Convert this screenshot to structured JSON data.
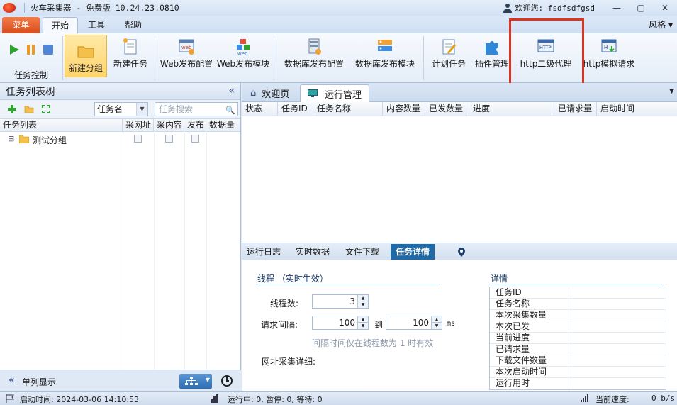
{
  "window": {
    "title": "火车采集器 - 免费版 10.24.23.0810",
    "user_label": "欢迎您: fsdfsdfgsd",
    "controls": [
      "—",
      "▢",
      "✕"
    ]
  },
  "ribbon_tabs": {
    "menu": "菜单",
    "tabs": [
      "开始",
      "工具",
      "帮助"
    ],
    "style_menu": "风格 ▾"
  },
  "ribbon": {
    "task_control_label": "任务控制",
    "buttons": {
      "new_group": "新建分组",
      "new_task": "新建任务",
      "web_publish_config": "Web发布配置",
      "web_publish_module": "Web发布模块",
      "db_publish_config": "数据库发布配置",
      "db_publish_module": "数据库发布模块",
      "scheduled_task": "计划任务",
      "plugin_manage": "插件管理",
      "http_proxy": "http二级代理",
      "http_simulate": "http模拟请求"
    },
    "icon_texts": {
      "web": "web",
      "http": "HTTP",
      "h": "H"
    }
  },
  "left_panel": {
    "title": "任务列表树",
    "collapse": "«",
    "filter_select": "任务名",
    "search_placeholder": "任务搜索",
    "columns": [
      "任务列表",
      "采网址",
      "采内容",
      "发布",
      "数据量"
    ],
    "tree_items": [
      {
        "expander": "⊞",
        "label": "测试分组"
      }
    ],
    "footer": {
      "toggle": "«",
      "single_view": "单列显示"
    }
  },
  "doc_tabs": {
    "welcome": "欢迎页",
    "run_manage": "运行管理"
  },
  "grid": {
    "columns": [
      "状态",
      "任务ID",
      "任务名称",
      "内容数量",
      "已发数量",
      "进度",
      "已请求量",
      "启动时间"
    ]
  },
  "bottom_tabs": [
    "运行日志",
    "实时数据",
    "文件下载",
    "任务详情"
  ],
  "detail": {
    "section_title": "线程 （实时生效）",
    "thread_label": "线程数:",
    "thread_value": "3",
    "interval_label": "请求间隔:",
    "interval_from": "100",
    "interval_to_label": "到",
    "interval_to": "100",
    "interval_unit": "ms",
    "interval_hint": "间隔时间仅在线程数为 1 时有效",
    "url_detail_label": "网址采集详细:",
    "info_title": "详情",
    "info_rows": [
      "任务ID",
      "任务名称",
      "本次采集数量",
      "本次已发",
      "当前进度",
      "已请求量",
      "下载文件数量",
      "本次启动时间",
      "运行用时"
    ]
  },
  "status_bar": {
    "start_time": "启动时间:  2024-03-06 14:10:53",
    "counts": "运行中: 0,  暂停: 0,  等待: 0",
    "speed_label": "当前速度:",
    "speed_value": "0 b/s"
  },
  "colors": {
    "accent": "#1f6aa6",
    "menu_orange": "#e2622e",
    "highlight_red": "#e0321f",
    "selected_yellow": "#ffd46a"
  }
}
